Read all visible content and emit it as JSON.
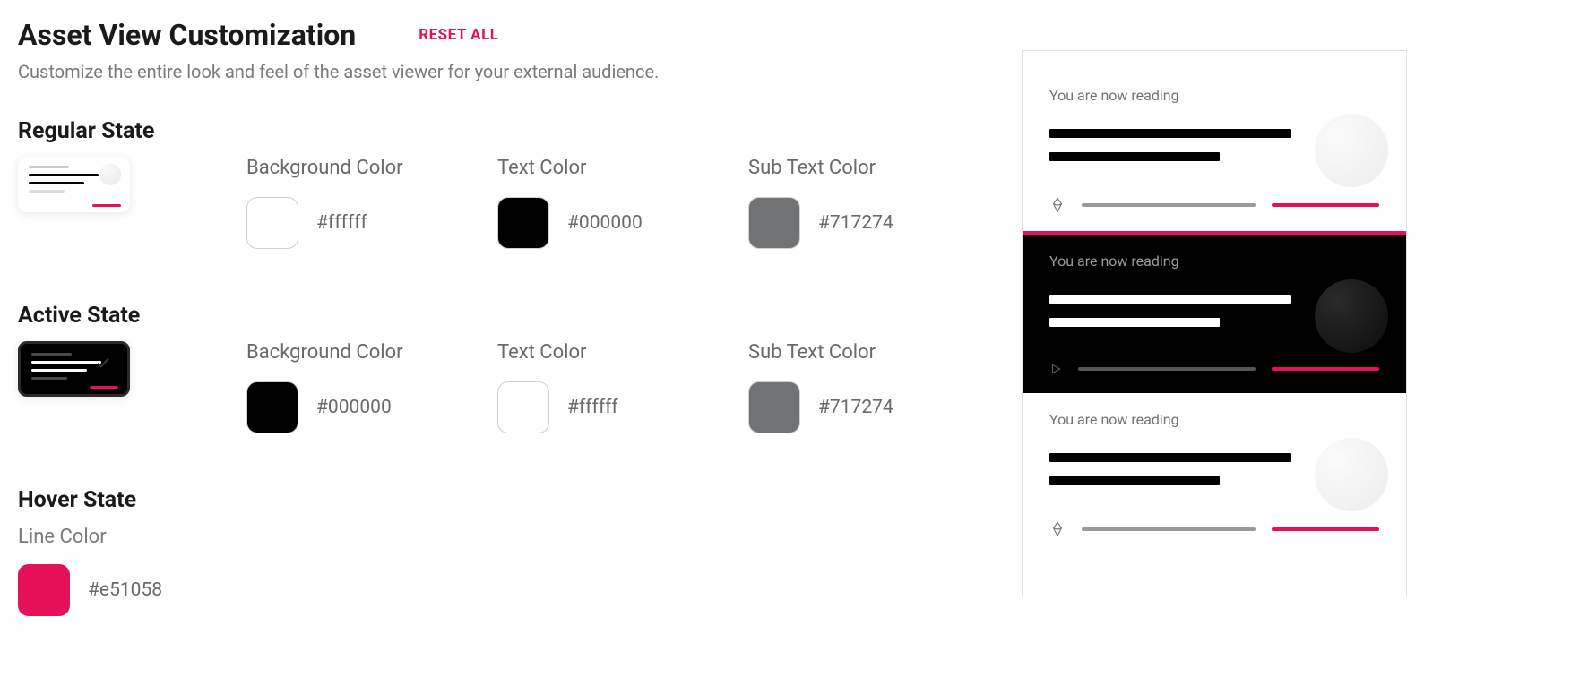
{
  "header": {
    "title": "Asset View Customization",
    "reset": "RESET ALL",
    "subtitle": "Customize the entire look and feel of the asset viewer for your external audience."
  },
  "sections": {
    "regular": {
      "title": "Regular State",
      "bg_label": "Background Color",
      "bg_value": "#ffffff",
      "text_label": "Text Color",
      "text_value": "#000000",
      "sub_label": "Sub Text Color",
      "sub_value": "#717274"
    },
    "active": {
      "title": "Active State",
      "bg_label": "Background Color",
      "bg_value": "#000000",
      "text_label": "Text Color",
      "text_value": "#ffffff",
      "sub_label": "Sub Text Color",
      "sub_value": "#717274"
    },
    "hover": {
      "title": "Hover State",
      "line_label": "Line Color",
      "line_value": "#e51058"
    }
  },
  "preview": {
    "item_subtitle": "You are now reading"
  }
}
